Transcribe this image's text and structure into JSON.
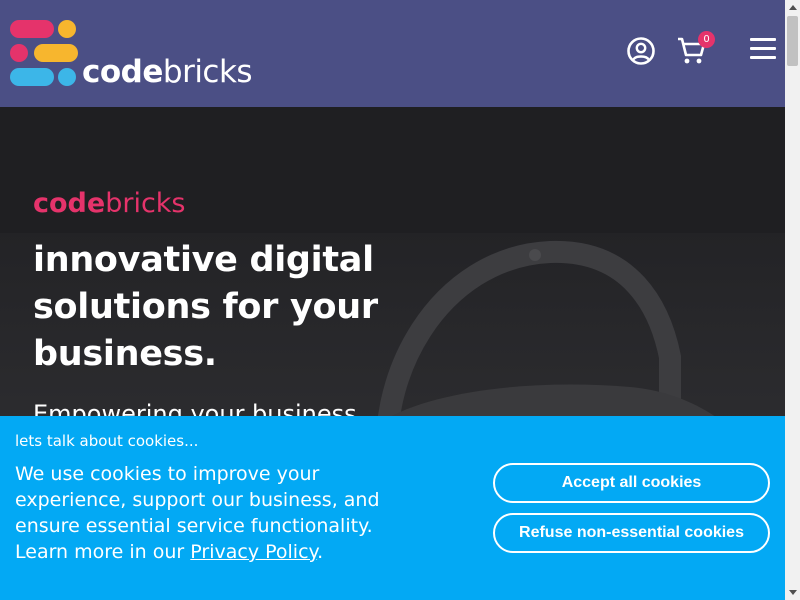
{
  "header": {
    "brand_bold": "code",
    "brand_light": "bricks",
    "cart_count": "0",
    "icons": [
      "user-icon",
      "cart-icon",
      "menu-icon"
    ]
  },
  "hero": {
    "brand_bold": "code",
    "brand_light": "bricks",
    "title": "innovative digital solutions for your business.",
    "subtitle": "Empowering your business"
  },
  "cookie": {
    "title": "lets talk about cookies...",
    "body": "We use cookies to improve your experience, support our business, and ensure essential service functionality. Learn more in our",
    "link": "Privacy Policy",
    "link_suffix": ".",
    "accept_label": "Accept all cookies",
    "refuse_label": "Refuse non-essential cookies"
  },
  "colors": {
    "header_bg": "#4b4f85",
    "accent_pink": "#e5336b",
    "accent_yellow": "#f7b62e",
    "accent_blue": "#3cb6e8",
    "cookie_bg": "#03a9f4"
  }
}
